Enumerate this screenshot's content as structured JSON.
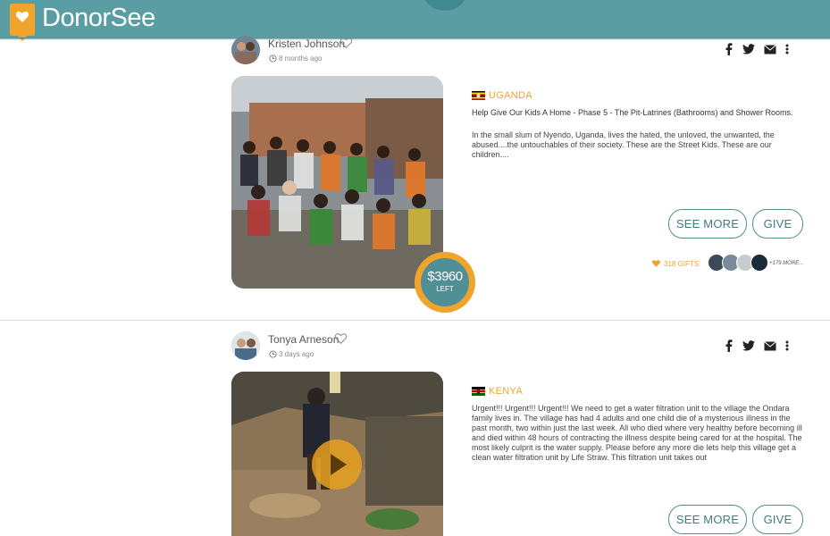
{
  "brand": {
    "name": "DonorSee"
  },
  "colors": {
    "header": "#5a9ea3",
    "accent": "#f0a42c",
    "teal": "#4f8f95"
  },
  "posts": [
    {
      "author": "Kristen Johnson",
      "time": "8 months ago",
      "country": "UGANDA",
      "title": "Help Give Our Kids A Home - Phase 5 - The Pit-Latrines (Bathrooms) and Shower Rooms.",
      "description": "In the small slum of Nyendo, Uganda, lives the hated, the unloved, the unwanted, the abused....the untouchables of their society.  These are the Street Kids.  These are our children....",
      "see_more_label": "SEE MORE",
      "give_label": "GIVE",
      "gifts": "318 GIFTS",
      "more_donors": "+179 MORE...",
      "amount_left": "$3960",
      "left_label": "LEFT",
      "media_icon": "photo"
    },
    {
      "author": "Tonya Arneson",
      "time": "3 days ago",
      "country": "KENYA",
      "description": "Urgent!!! Urgent!!! Urgent!!! We need to get a water filtration unit to the village the Ondara family lives in. The village  has had 4 adults and one child die of a mysterious illness in the past month, two within just the last week. All who died where very healthy before becoming ill and died within 48 hours of contracting the illness despite being cared for at the hospital. The most likely culprit is the water supply. Please before any more die lets help this village get a clean water filtration unit by Life Straw. This filtration unit takes out",
      "see_more_label": "SEE MORE",
      "give_label": "GIVE",
      "media_icon": "play-icon"
    }
  ],
  "social_icons": [
    "facebook-icon",
    "twitter-icon",
    "email-icon",
    "more-vertical-icon"
  ]
}
